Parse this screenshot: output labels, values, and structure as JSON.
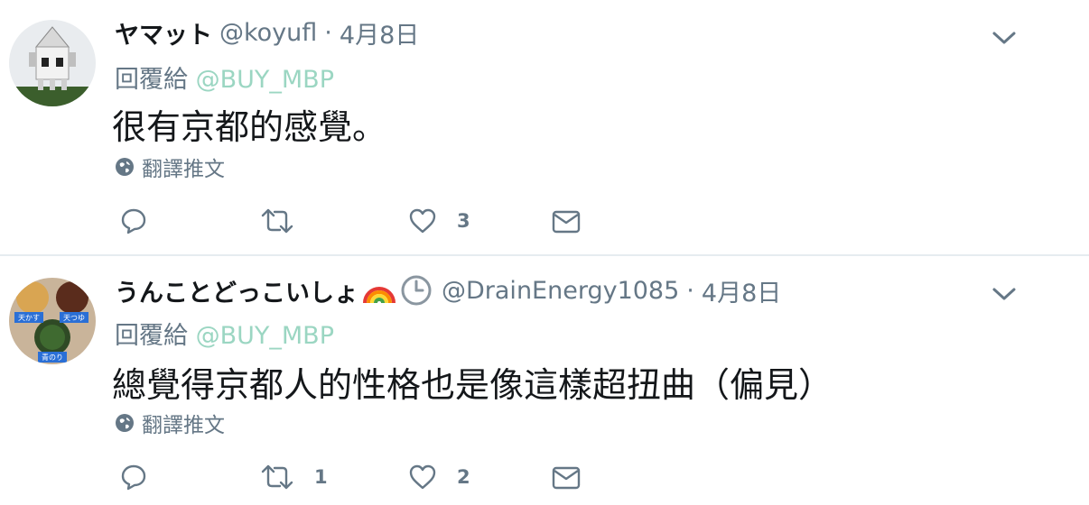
{
  "tweets": [
    {
      "display_name": "ヤマット",
      "handle": "@koyufl",
      "separator": "·",
      "date": "4月8日",
      "reply_prefix": "回覆給",
      "reply_to": "@BUY_MBP",
      "text": "很有京都的感覺。",
      "translate": "翻譯推文",
      "reply_count": "",
      "retweet_count": "",
      "like_count": "3"
    },
    {
      "display_name": "うんことどっこいしょ",
      "name_emojis": [
        "rainbow-icon",
        "clock-icon"
      ],
      "handle": "@DrainEnergy1085",
      "separator": "·",
      "date": "4月8日",
      "reply_prefix": "回覆給",
      "reply_to": "@BUY_MBP",
      "text": "總覺得京都人的性格也是像這樣超扭曲（偏見）",
      "translate": "翻譯推文",
      "reply_count": "",
      "retweet_count": "1",
      "like_count": "2",
      "avatar_labels": [
        "天かす",
        "天つゆ",
        "青のり"
      ]
    }
  ],
  "colors": {
    "link": "#9bd6c2",
    "secondary": "#657786",
    "text": "#14171a",
    "divider": "#e6ecf0"
  }
}
